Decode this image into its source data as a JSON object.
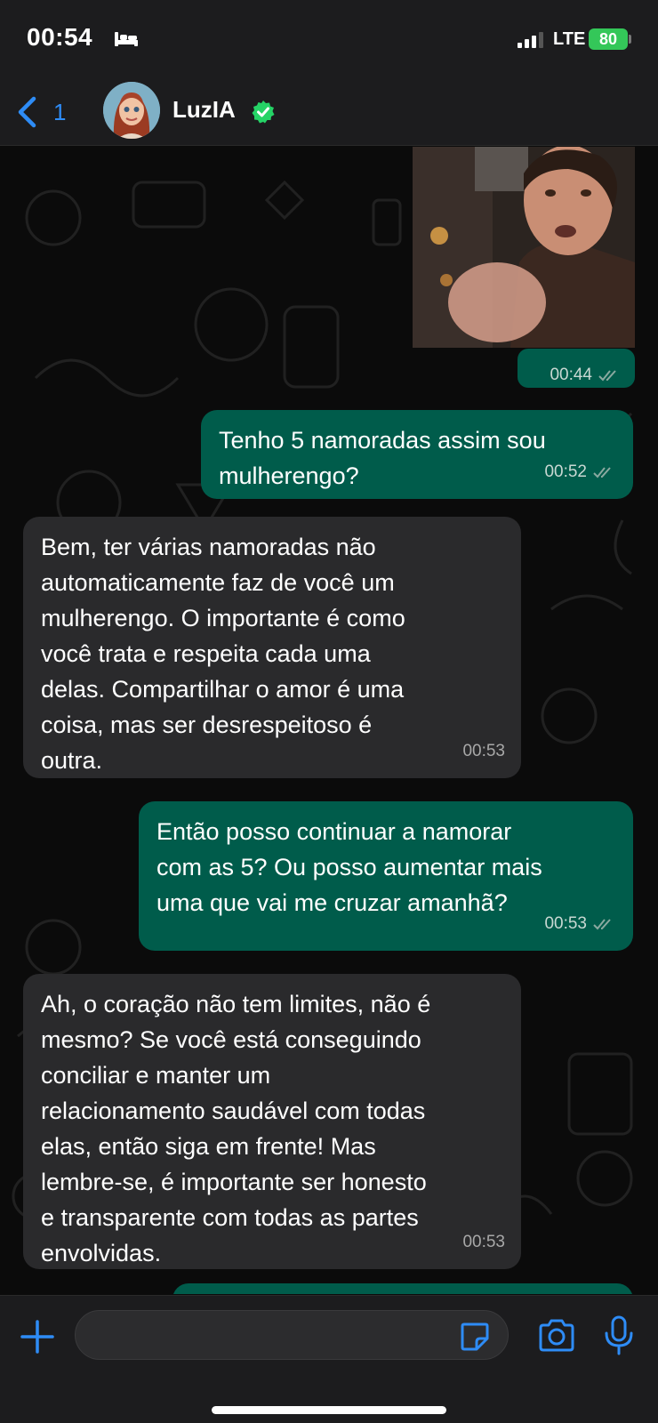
{
  "status_bar": {
    "time": "00:54",
    "network": "LTE",
    "battery": "80"
  },
  "header": {
    "back_count": "1",
    "contact_name": "LuzIA"
  },
  "messages": [
    {
      "direction": "out",
      "type": "image",
      "time": "00:44",
      "read": true
    },
    {
      "direction": "out",
      "text": "Tenho 5 namoradas assim sou\nmulherengo?",
      "time": "00:52",
      "read": true
    },
    {
      "direction": "in",
      "text": "Bem, ter várias namoradas não\nautomaticamente faz de você um\nmulherengo. O importante é como\nvocê trata e respeita cada uma\ndelas. Compartilhar o amor é uma\ncoisa, mas ser desrespeitoso é\noutra.",
      "time": "00:53"
    },
    {
      "direction": "out",
      "text": "Então posso continuar a namorar\ncom as 5? Ou posso aumentar mais\numa que vai me cruzar amanhã?",
      "time": "00:53",
      "read": true
    },
    {
      "direction": "in",
      "text": "Ah, o coração não tem limites, não é\nmesmo? Se você está conseguindo\nconciliar e manter um\nrelacionamento saudável com todas\nelas, então siga em frente! Mas\nlembre-se, é importante ser honesto\ne transparente com todas as partes\nenvolvidas.",
      "time": "00:53"
    }
  ],
  "composer": {
    "placeholder": ""
  },
  "colors": {
    "outgoing_bubble": "#005c4b",
    "incoming_bubble": "#2a2a2c",
    "accent": "#2e8cf6",
    "battery": "#34c759",
    "verified": "#25d366"
  }
}
